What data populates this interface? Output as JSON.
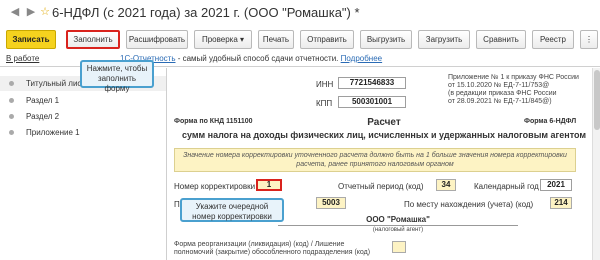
{
  "window": {
    "title": "6-НДФЛ (с 2021 года) за 2021 г. (ООО \"Ромашка\") *"
  },
  "toolbar": {
    "save": "Записать",
    "fill": "Заполнить",
    "decode": "Расшифровать",
    "check": "Проверка",
    "print": "Печать",
    "send": "Отправить",
    "export": "Выгрузить",
    "import": "Загрузить",
    "compare": "Сравнить",
    "registry": "Реестр"
  },
  "subbar": {
    "status": "В работе",
    "link": "1С-Отчетность",
    "promo": " - самый удобный способ сдачи отчетности. ",
    "more": "Подробнее"
  },
  "left_panel": {
    "items": [
      "Титульный лист",
      "Раздел 1",
      "Раздел 2",
      "Приложение 1"
    ]
  },
  "tooltips": {
    "fill": "Нажмите, чтобы заполнить форму",
    "correction": "Укажите очередной номер корректировки"
  },
  "form": {
    "inn_label": "ИНН",
    "inn_value": "7721546833",
    "kpp_label": "КПП",
    "kpp_value": "500301001",
    "appendix_1": "Приложение № 1 к приказу ФНС России",
    "appendix_2": "от 15.10.2020 № ЕД-7-11/753@",
    "appendix_3": "(в редакции приказа ФНС России",
    "appendix_4": "от 28.09.2021 № ЕД-7-11/845@)",
    "knd": "Форма по КНД 1151100",
    "form_name": "Форма 6-НДФЛ",
    "heading": "Расчет",
    "subheading": "сумм налога на доходы физических лиц, исчисленных и удержанных налоговым агентом",
    "notice": "Значение номера корректировки уточненного расчета должно быть на 1 больше значения номера корректировки расчета, ранее принятого налоговым органом",
    "correction_label": "Номер корректировки",
    "correction_value": "1",
    "period_label": "Отчетный период (код)",
    "period_value": "34",
    "year_label": "Календарный год",
    "year_value": "2021",
    "tax_org_label": "Пр",
    "tax_org_value": "5003",
    "location_label": "По месту нахождения (учета) (код)",
    "location_value": "214",
    "agent_name": "ООО \"Ромашка\"",
    "agent_caption": "(налоговый агент)",
    "reorg_label_1": "Форма реорганизации (ликвидация) (код) / Лишение",
    "reorg_label_2": "полномочий (закрытие) обособленного подразделения (код)"
  }
}
